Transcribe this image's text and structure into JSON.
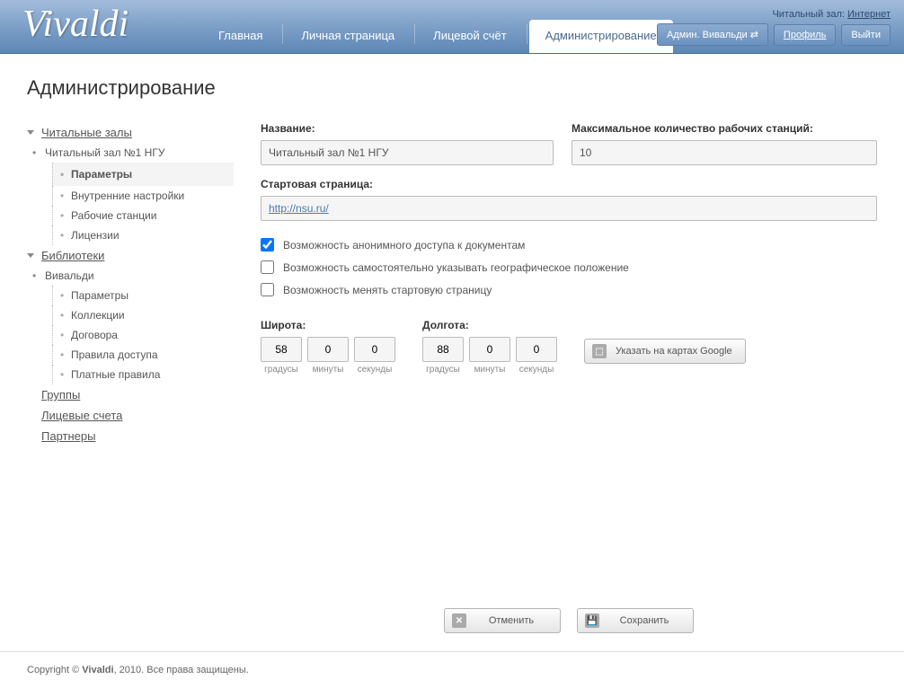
{
  "brand": "Vivaldi",
  "topright": {
    "label": "Читальный зал:",
    "link": "Интернет"
  },
  "nav": {
    "items": [
      "Главная",
      "Личная страница",
      "Лицевой счёт",
      "Администрирование"
    ],
    "active": 3
  },
  "user": {
    "admin": "Админ. Вивальди ⇄",
    "profile": "Профиль",
    "logout": "Выйти"
  },
  "page_title": "Администрирование",
  "sidebar": {
    "reading_rooms": "Читальные залы",
    "room1": "Читальный зал №1 НГУ",
    "room1_items": [
      "Параметры",
      "Внутренние настройки",
      "Рабочие станции",
      "Лицензии"
    ],
    "libraries": "Библиотеки",
    "lib1": "Вивальди",
    "lib1_items": [
      "Параметры",
      "Коллекции",
      "Договора",
      "Правила доступа",
      "Платные правила"
    ],
    "groups": "Группы",
    "accounts": "Лицевые счета",
    "partners": "Партнеры"
  },
  "form": {
    "name_label": "Название:",
    "name_value": "Читальный зал №1 НГУ",
    "max_label": "Максимальное количество рабочих станций:",
    "max_value": "10",
    "start_label": "Стартовая страница:",
    "start_value": "http://nsu.ru/",
    "check1": "Возможность анонимного доступа к документам",
    "check2": "Возможность самостоятельно указывать географическое положение",
    "check3": "Возможность менять стартовую страницу",
    "lat_label": "Широта:",
    "lon_label": "Долгота:",
    "deg": "градусы",
    "min": "минуты",
    "sec": "секунды",
    "lat": {
      "d": "58",
      "m": "0",
      "s": "0"
    },
    "lon": {
      "d": "88",
      "m": "0",
      "s": "0"
    },
    "map_btn": "Указать на картах Google",
    "cancel": "Отменить",
    "save": "Сохранить"
  },
  "footer": {
    "copyright": "Copyright © ",
    "brand": "Vivaldi",
    "rest": ", 2010. Все права защищены."
  }
}
